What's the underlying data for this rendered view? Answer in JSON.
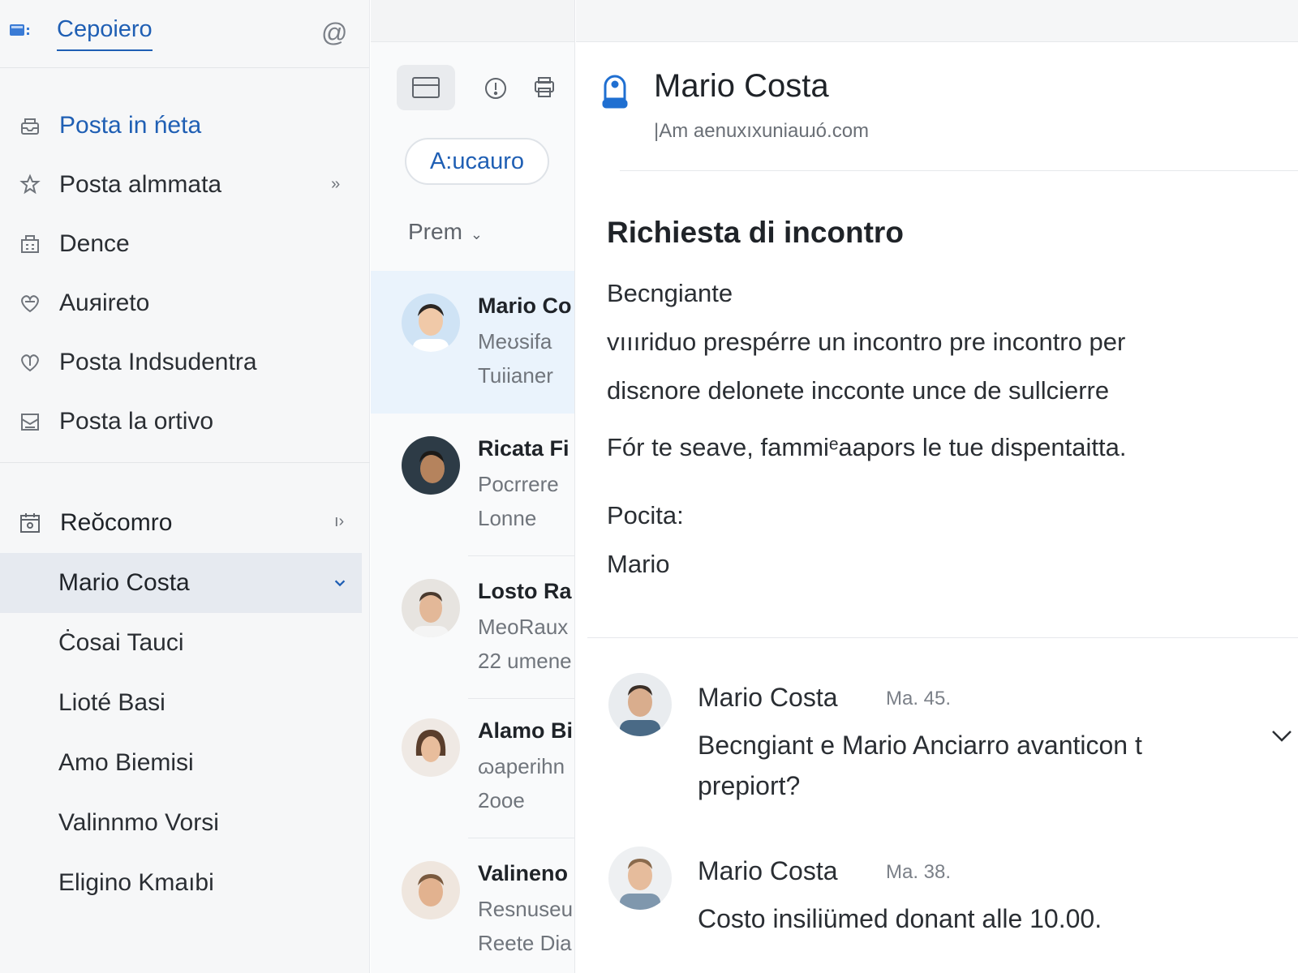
{
  "app": {
    "title": "Cepoiero"
  },
  "sidebar": {
    "folders": [
      {
        "label": "Posta in ńeta",
        "icon": "inbox-icon",
        "active": true
      },
      {
        "label": "Posta almmata",
        "icon": "star-icon",
        "chevron": "››"
      },
      {
        "label": "Dence",
        "icon": "building-icon"
      },
      {
        "label": "Auяireto",
        "icon": "heart-icon"
      },
      {
        "label": "Posta Indsudentra",
        "icon": "shield-heart-icon"
      },
      {
        "label": "Posta la ortivo",
        "icon": "archive-icon"
      }
    ],
    "section": {
      "label": "Reŏcomro",
      "icon": "calendar-icon",
      "chevron": "ı›"
    },
    "contacts": [
      {
        "label": "Mario Costa",
        "selected": true
      },
      {
        "label": "Ċosai Tauci"
      },
      {
        "label": "Lioté Basi"
      },
      {
        "label": "Amo  Biemisi"
      },
      {
        "label": "Valinnmo Vorsi"
      },
      {
        "label": "Eligino Kmaıbi"
      }
    ]
  },
  "list": {
    "filter_label": "A:ucauro",
    "sort_label": "Prem",
    "messages": [
      {
        "name": "Mario Co",
        "line2": "Meʊsifa",
        "line3": "Tuiianer",
        "selected": true
      },
      {
        "name": "Ricata Fi",
        "line2": "Pocrrere",
        "line3": "Lonne"
      },
      {
        "name": "Losto Ra",
        "line2": "MeoRaux",
        "line3": "22 umene"
      },
      {
        "name": "Alamo Bi",
        "line2": "ɷaperihn",
        "line3": "2ooe"
      },
      {
        "name": "Valineno",
        "line2": "Resnuseu",
        "line3": "Reete Dia"
      }
    ]
  },
  "reader": {
    "sender_name": "Mario Costa",
    "sender_email": "|Am aenuxıxuniauɹó.com",
    "subject": "Richiesta di incontro",
    "body": [
      "Becngiante",
      "vıııriduo prespérre un incontro pre incontro per",
      "disɛnore delonete inccontе unce de sullcierre",
      "Fór te seave, fammiᵉaapors le tue dispentaitta.",
      "Pocita:",
      "Mario"
    ],
    "replies": [
      {
        "name": "Mario Costa",
        "time": "Ma. 45.",
        "text": "Becngiant e  Mario Anciarro avanticon t prepiort?"
      },
      {
        "name": "Mario Costa",
        "time": "Ma. 38.",
        "text": "Costo insiliümed donant alle 10.00."
      }
    ]
  },
  "colors": {
    "accent": "#1f5fb4",
    "selected_bg": "#eaf3fc",
    "sidebar_bg": "#f6f7f8"
  }
}
